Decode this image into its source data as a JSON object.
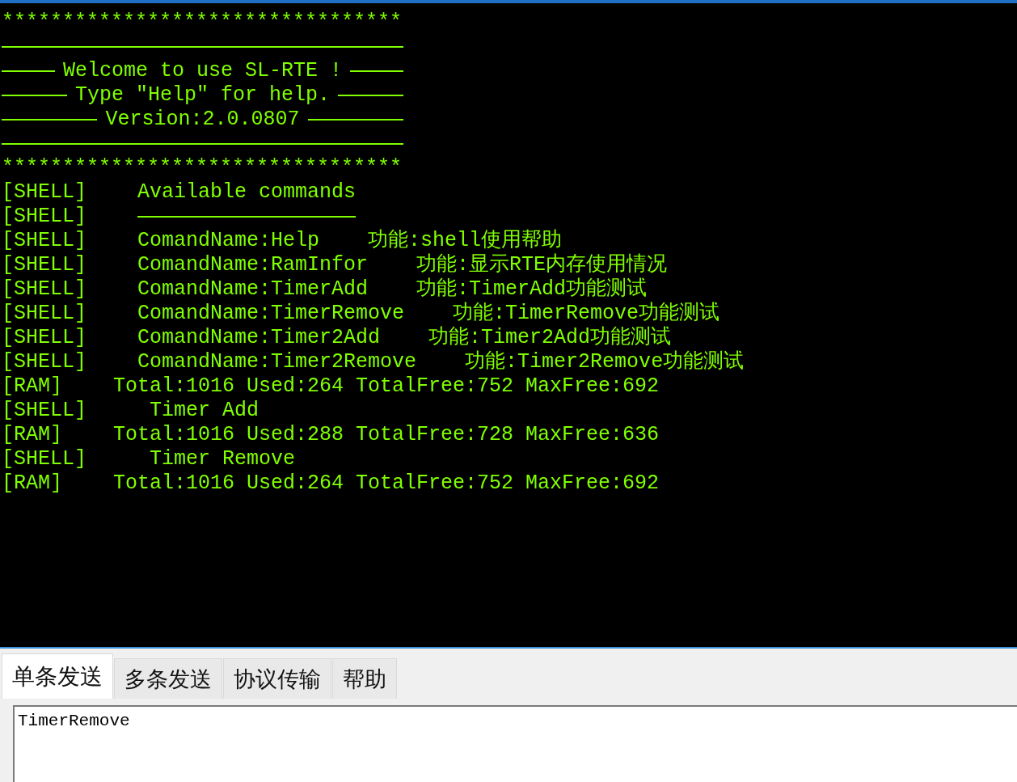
{
  "terminal": {
    "lines": [
      {
        "kind": "text",
        "text": "*********************************"
      },
      {
        "kind": "rule"
      },
      {
        "kind": "banner",
        "text": "Welcome to use SL-RTE !"
      },
      {
        "kind": "banner",
        "text": "Type \"Help\" for help."
      },
      {
        "kind": "banner",
        "text": "Version:2.0.0807"
      },
      {
        "kind": "rule"
      },
      {
        "kind": "text",
        "text": "*********************************"
      },
      {
        "kind": "log",
        "tag": "[SHELL]",
        "text": "Available commands"
      },
      {
        "kind": "log-rule",
        "tag": "[SHELL]"
      },
      {
        "kind": "log",
        "tag": "[SHELL]",
        "text": "ComandName:Help    功能:shell使用帮助"
      },
      {
        "kind": "log",
        "tag": "[SHELL]",
        "text": "ComandName:RamInfor    功能:显示RTE内存使用情况"
      },
      {
        "kind": "log",
        "tag": "[SHELL]",
        "text": "ComandName:TimerAdd    功能:TimerAdd功能测试"
      },
      {
        "kind": "log",
        "tag": "[SHELL]",
        "text": "ComandName:TimerRemove    功能:TimerRemove功能测试"
      },
      {
        "kind": "log",
        "tag": "[SHELL]",
        "text": "ComandName:Timer2Add    功能:Timer2Add功能测试"
      },
      {
        "kind": "log",
        "tag": "[SHELL]",
        "text": "ComandName:Timer2Remove    功能:Timer2Remove功能测试"
      },
      {
        "kind": "log",
        "tag": "[RAM]",
        "text": "Total:1016 Used:264 TotalFree:752 MaxFree:692"
      },
      {
        "kind": "log",
        "tag": "[SHELL]",
        "text": " Timer Add"
      },
      {
        "kind": "log",
        "tag": "[RAM]",
        "text": "Total:1016 Used:288 TotalFree:728 MaxFree:636"
      },
      {
        "kind": "log",
        "tag": "[SHELL]",
        "text": " Timer Remove"
      },
      {
        "kind": "log",
        "tag": "[RAM]",
        "text": "Total:1016 Used:264 TotalFree:752 MaxFree:692"
      }
    ]
  },
  "tabs": [
    {
      "label": "单条发送",
      "selected": true
    },
    {
      "label": "多条发送",
      "selected": false
    },
    {
      "label": "协议传输",
      "selected": false
    },
    {
      "label": "帮助",
      "selected": false
    }
  ],
  "send_field": {
    "value": "TimerRemove"
  }
}
